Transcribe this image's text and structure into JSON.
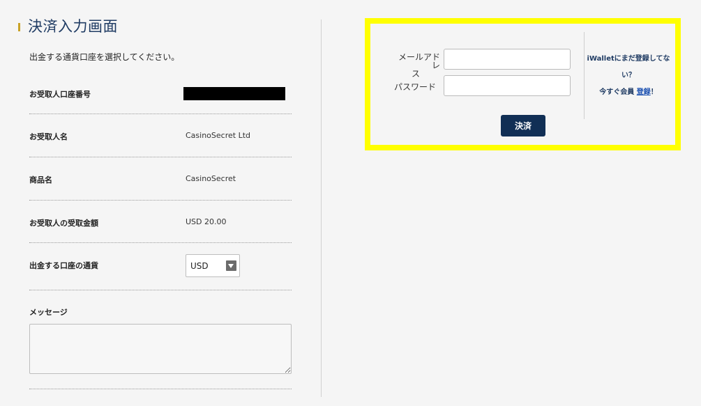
{
  "page": {
    "title": "決済入力画面",
    "instruction": "出金する通貨口座を選択してください。"
  },
  "details": {
    "account_number_label": "お受取人口座番号",
    "recipient_name_label": "お受取人名",
    "recipient_name_value": "CasinoSecret Ltd",
    "product_label": "商品名",
    "product_value": "CasinoSecret",
    "amount_label": "お受取人の受取金額",
    "amount_value": "USD 20.00",
    "currency_label": "出金する口座の通貨",
    "currency_value": "USD",
    "message_label": "メッセージ"
  },
  "login": {
    "email_label_line1": "メールアドレ",
    "email_label_line2": "ス",
    "password_label": "パスワード",
    "submit_label": "決済",
    "register_line1": "iWalletにまだ登録してな",
    "register_line2": "い？",
    "register_prefix": "今すぐ会員",
    "register_link": "登録",
    "register_suffix": "！",
    "highlight_color": "#ffff00",
    "button_color": "#112f55"
  }
}
